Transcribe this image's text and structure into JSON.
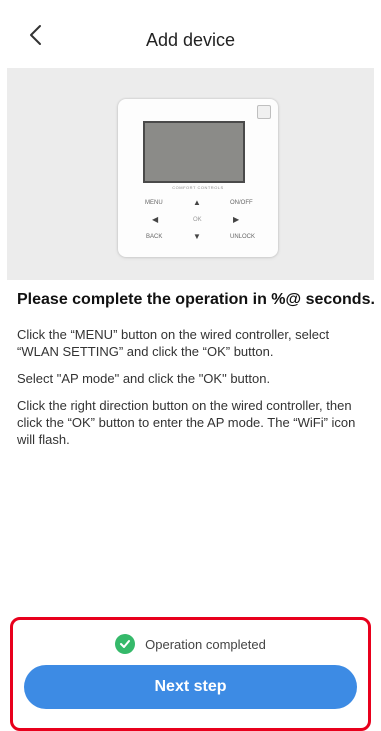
{
  "header": {
    "title": "Add device"
  },
  "controller": {
    "brand": "COMFORT CONTROLS",
    "menu": "MENU",
    "onoff": "ON/OFF",
    "ok": "OK",
    "back": "BACK",
    "unlock": "UNLOCK"
  },
  "instructions": {
    "heading": "Please complete the operation in %@ seconds.",
    "steps": [
      "Click the “MENU” button on the wired controller, select “WLAN SETTING” and click the “OK” button.",
      "Select \"AP mode\" and click the \"OK\" button.",
      "Click the right direction button on the wired controller, then click the “OK” button to enter the AP mode. The “WiFi” icon will flash."
    ]
  },
  "footer": {
    "status": "Operation completed",
    "next_label": "Next step"
  },
  "colors": {
    "accent": "#3d8be4",
    "success": "#35b96a",
    "highlight": "#e8001c"
  }
}
